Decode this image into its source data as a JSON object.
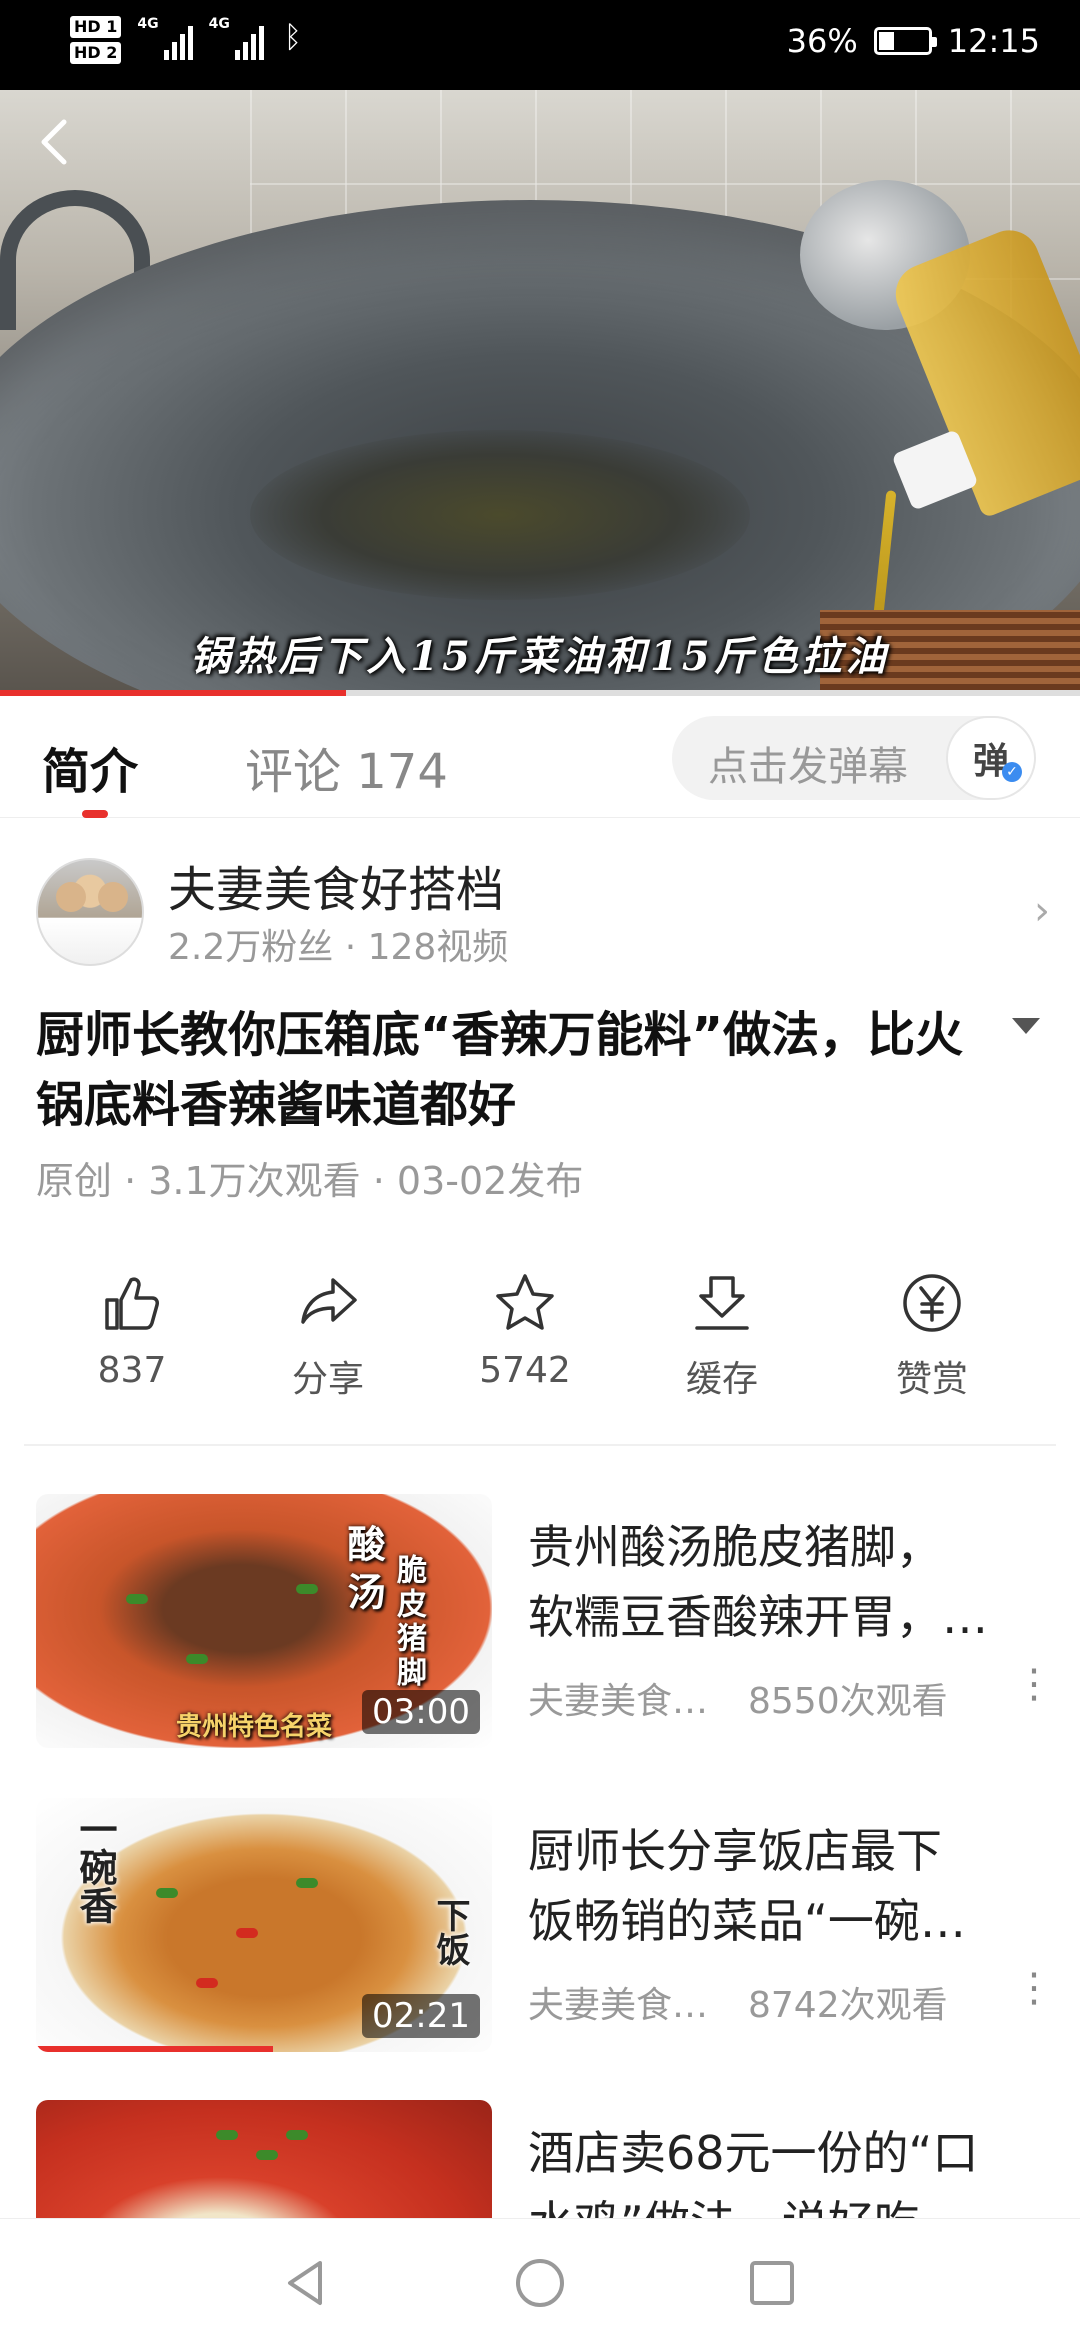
{
  "status_bar": {
    "network_badges": [
      "HD 1",
      "HD 2"
    ],
    "signal_labels": [
      "4G",
      "4G"
    ],
    "bluetooth_icon": "bluetooth-icon",
    "battery_percent": "36%",
    "battery_level": 0.36,
    "time": "12:15"
  },
  "video": {
    "subtitle": "锅热后下入15斤菜油和15斤色拉油",
    "progress": 0.32
  },
  "tabs": {
    "intro": "简介",
    "comments": "评论 174",
    "danmu_placeholder": "点击发弹幕",
    "danmu_button": "弹"
  },
  "author": {
    "name": "夫妻美食好搭档",
    "meta": "2.2万粉丝 · 128视频"
  },
  "title": {
    "text": "厨师长教你压箱底“香辣万能料”做法，比火锅底料香辣酱味道都好",
    "meta": "原创 · 3.1万次观看 · 03-02发布"
  },
  "actions": [
    {
      "icon": "thumbs-up-icon",
      "label": "837"
    },
    {
      "icon": "share-icon",
      "label": "分享"
    },
    {
      "icon": "star-icon",
      "label": "5742"
    },
    {
      "icon": "download-icon",
      "label": "缓存"
    },
    {
      "icon": "yuan-icon",
      "label": "赞赏"
    }
  ],
  "recommended": [
    {
      "title_line1": "贵州酸汤脆皮猪脚，",
      "title_line2": "软糯豆香酸辣开胃，…",
      "author": "夫妻美食…",
      "views": "8550次观看",
      "duration": "03:00",
      "thumb_text_a": "酸汤",
      "thumb_text_b": "脆皮猪脚",
      "thumb_text_c": "贵州特色名菜",
      "watched": 0
    },
    {
      "title_line1": "厨师长分享饭店最下",
      "title_line2": "饭畅销的菜品“一碗…",
      "author": "夫妻美食…",
      "views": "8742次观看",
      "duration": "02:21",
      "thumb_text_a": "一碗香",
      "thumb_text_b": "下饭",
      "watched": 0.52
    },
    {
      "title_line1": "酒店卖68元一份的“口",
      "title_line2": "水鸡”做法，说好吃，…"
    }
  ],
  "navbar": [
    "back-triangle-icon",
    "home-circle-icon",
    "recents-square-icon"
  ]
}
